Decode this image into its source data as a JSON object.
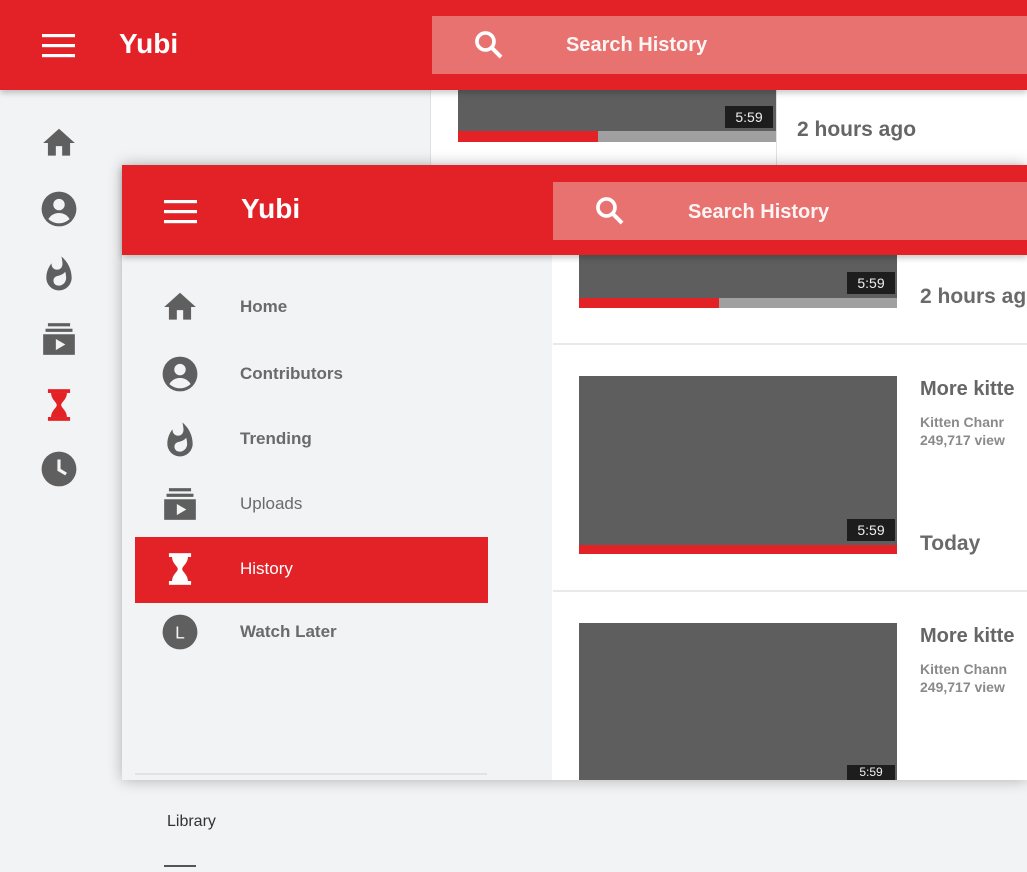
{
  "colors": {
    "accent": "#e32227",
    "search_bg": "#e87270",
    "icon_gray": "#5f5f5f",
    "thumb": "#5e5e5e"
  },
  "back_window": {
    "logo": "Yubi",
    "search_placeholder": "Search History",
    "rail_icons": [
      "home-icon",
      "contributors-icon",
      "trending-icon",
      "uploads-icon",
      "history-icon",
      "watch-later-icon"
    ],
    "active_icon": "history-icon",
    "video": {
      "duration": "5:59",
      "progress": 0.44,
      "timestamp": "2 hours ago"
    }
  },
  "front_window": {
    "logo": "Yubi",
    "search_placeholder": "Search History",
    "sidebar": {
      "items": [
        {
          "label": "Home",
          "icon": "home-icon"
        },
        {
          "label": "Contributors",
          "icon": "contributors-icon"
        },
        {
          "label": "Trending",
          "icon": "trending-icon"
        },
        {
          "label": "Uploads",
          "icon": "uploads-icon"
        },
        {
          "label": "History",
          "icon": "history-icon",
          "active": true
        },
        {
          "label": "Watch Later",
          "icon": "watch-later-icon"
        }
      ],
      "library_label": "Library"
    },
    "videos": [
      {
        "duration": "5:59",
        "progress": 0.44,
        "timestamp": "2 hours ag"
      },
      {
        "duration": "5:59",
        "progress": 1.0,
        "title": "More kitte",
        "channel": "Kitten Chanr",
        "views": "249,717 view",
        "timestamp": "Today"
      },
      {
        "duration": "5:59",
        "title": "More kitte",
        "channel": "Kitten Chann",
        "views": "249,717 view"
      }
    ]
  }
}
